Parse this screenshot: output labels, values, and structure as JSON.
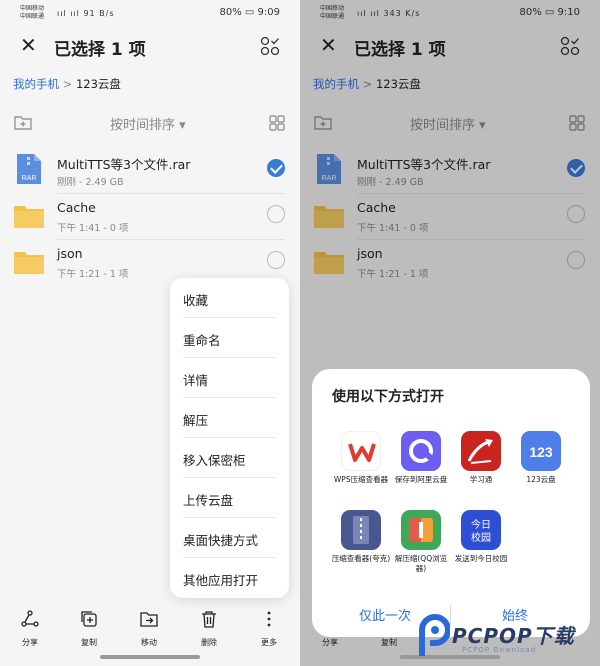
{
  "left": {
    "status": {
      "carrier_1": "中国移动",
      "carrier_2": "中国联通",
      "signal": "ııl ııl",
      "speed_num": "91",
      "speed_unit": "B/s",
      "battery": "80%",
      "time": "9:09"
    },
    "header": {
      "title": "已选择 1 项"
    },
    "breadcrumb": {
      "root": "我的手机",
      "sep": ">",
      "current": "123云盘"
    },
    "sort": {
      "label": "按时间排序 ▾"
    },
    "files": [
      {
        "name": "MultiTTS等3个文件.rar",
        "meta": "刚刚 - 2.49 GB",
        "icon_label": "RAR",
        "selected": true
      },
      {
        "name": "Cache",
        "meta": "下午 1:41 - 0 项",
        "selected": false
      },
      {
        "name": "json",
        "meta": "下午 1:21 - 1 项",
        "selected": false
      }
    ],
    "menu": {
      "items": [
        "收藏",
        "重命名",
        "详情",
        "解压",
        "移入保密柜",
        "上传云盘",
        "桌面快捷方式",
        "其他应用打开"
      ]
    },
    "toolbar": {
      "share": "分享",
      "copy": "复制",
      "move": "移动",
      "delete": "删除",
      "more": "更多"
    }
  },
  "right": {
    "status": {
      "carrier_1": "中国移动",
      "carrier_2": "中国联通",
      "signal": "ııl ııl",
      "speed_num": "343",
      "speed_unit": "K/s",
      "battery": "80%",
      "time": "9:10"
    },
    "header": {
      "title": "已选择 1 项"
    },
    "breadcrumb": {
      "root": "我的手机",
      "sep": ">",
      "current": "123云盘"
    },
    "sort": {
      "label": "按时间排序 ▾"
    },
    "files": [
      {
        "name": "MultiTTS等3个文件.rar",
        "meta": "刚刚 - 2.49 GB",
        "icon_label": "RAR",
        "selected": true
      },
      {
        "name": "Cache",
        "meta": "下午 1:41 - 0 项",
        "selected": false
      },
      {
        "name": "json",
        "meta": "下午 1:21 - 1 项",
        "selected": false
      }
    ],
    "toolbar": {
      "share": "分享",
      "copy": "复制"
    },
    "sheet": {
      "title": "使用以下方式打开",
      "apps": [
        {
          "label": "WPS压缩查看器",
          "color": "#ffffff",
          "glyph": "W"
        },
        {
          "label": "保存到阿里云盘",
          "color": "#6b5ef0",
          "glyph": "◯"
        },
        {
          "label": "学习通",
          "color": "#c9241d",
          "glyph": "➶"
        },
        {
          "label": "123云盘",
          "color": "#4f7ee8",
          "glyph": "123"
        },
        {
          "label": "压缩查看器(夸克)",
          "color": "#4a5690",
          "glyph": "▦"
        },
        {
          "label": "解压缩(QQ浏览器)",
          "color": "#3fa65a",
          "glyph": "▥"
        },
        {
          "label": "发送到今日校园",
          "color": "#2d4fd6",
          "glyph": "今日校园"
        }
      ],
      "once": "仅此一次",
      "always": "始终"
    },
    "watermark": {
      "brand": "PCPOP下载",
      "sub": "PCPOP Download"
    }
  },
  "colors": {
    "accent": "#3a7bd5",
    "link": "#2f6de0",
    "folder": "#f2c14e",
    "rar": "#5b8de0"
  }
}
